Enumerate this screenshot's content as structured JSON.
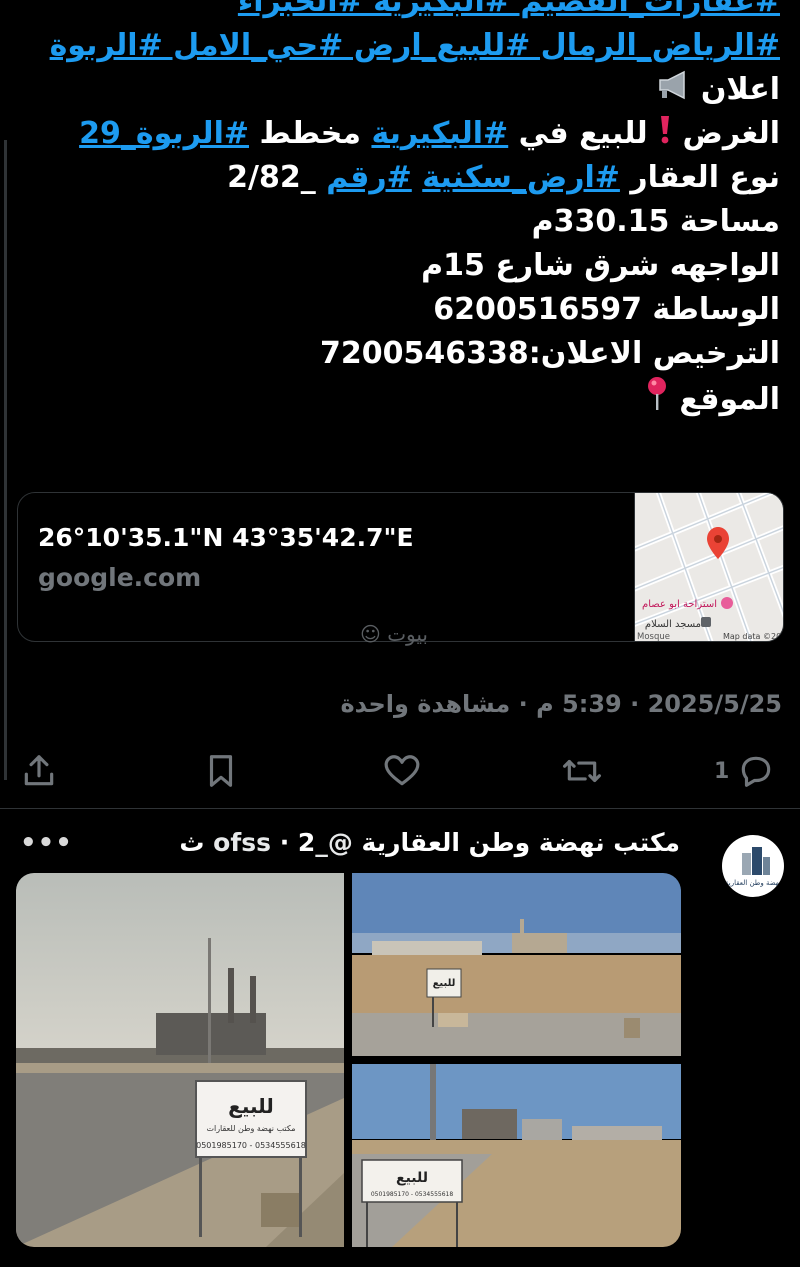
{
  "post": {
    "hashtags_line_1": "#عقارات_القصيم #البكيرية #الخبراء",
    "hashtags_line_2": "#الرياض_الرمال #للبيع_ارض #حي_الامل #الربوة",
    "announcement": "اعلان",
    "purpose_label": "الغرض",
    "purpose_for_sale_in": "للبيع في",
    "purpose_tag_city": "#البكيرية",
    "purpose_plan": "مخطط",
    "purpose_tag_plan": "#الربوة_29",
    "type_label": "نوع العقار",
    "type_tag": "#ارض_سكنية",
    "number_tag": "#رقم",
    "number_value": "_2/82",
    "area": "مساحة 330.15م",
    "facade": "الواجهه شرق شارع 15م",
    "brokerage": "الوساطة 6200516597",
    "license": "الترخيص الاعلان:7200546338",
    "location_label": "الموقع"
  },
  "link_card": {
    "title": "26°10'35.1\"N 43°35'42.7\"E",
    "domain": "google.com",
    "map_label_place": "استراحة ابو عصام",
    "map_label_mosque": "مسجد السلام",
    "map_label_mosque_en": "Mosque",
    "map_attribution": "Map data ©20"
  },
  "watermark": "بيوت",
  "meta": {
    "views_text": "2025/5/25 · 5:39 م · مشاهدة واحدة"
  },
  "actions": {
    "reply_count": "1"
  },
  "post2": {
    "author_name": "مكتب نهضة وطن العقارية",
    "handle": "@_ofss",
    "time": "· 2 ث",
    "avatar_caption": "نهضة وطن العقارية",
    "sign_text": "للبيع",
    "sign_office": "مكتب نهضة وطن للعقارات",
    "sign_phones": "0501985170 - 0534555618"
  },
  "colors": {
    "accent": "#1d9bf0",
    "muted": "#71767b",
    "pin": "#e0245e"
  }
}
